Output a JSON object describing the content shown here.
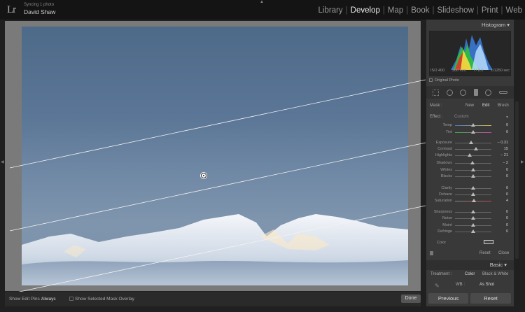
{
  "app": {
    "logo": "Lr",
    "sync_status": "Syncing 1 photo",
    "user": "David Shaw"
  },
  "modules": [
    {
      "label": "Library"
    },
    {
      "label": "Develop",
      "active": true
    },
    {
      "label": "Map"
    },
    {
      "label": "Book"
    },
    {
      "label": "Slideshow"
    },
    {
      "label": "Print"
    },
    {
      "label": "Web"
    }
  ],
  "histogram": {
    "title": "Histogram",
    "iso": "ISO 400",
    "focal": "200 mm",
    "aperture": "f / 8.0",
    "shutter": "1/1250 sec",
    "original_photo": "Original Photo"
  },
  "mask": {
    "label": "Mask :",
    "new": "New",
    "edit": "Edit",
    "brush": "Brush"
  },
  "effect": {
    "label": "Effect :",
    "value": "Custom"
  },
  "sliders": [
    {
      "label": "Temp",
      "value": "0",
      "level": 0.5
    },
    {
      "label": "Tint",
      "value": "0",
      "level": 0.5
    },
    {
      "label": "Exposure",
      "value": "− 0.31",
      "level": 0.45
    },
    {
      "label": "Contrast",
      "value": "15",
      "level": 0.58
    },
    {
      "label": "Highlights",
      "value": "− 21",
      "level": 0.4
    },
    {
      "label": "Shadows",
      "value": "− 2",
      "level": 0.49
    },
    {
      "label": "Whites",
      "value": "0",
      "level": 0.5
    },
    {
      "label": "Blacks",
      "value": "0",
      "level": 0.5
    },
    {
      "label": "Clarity",
      "value": "0",
      "level": 0.5
    },
    {
      "label": "Dehaze",
      "value": "0",
      "level": 0.5
    },
    {
      "label": "Saturation",
      "value": "4",
      "level": 0.52
    },
    {
      "label": "Sharpness",
      "value": "0",
      "level": 0.5
    },
    {
      "label": "Noise",
      "value": "0",
      "level": 0.5
    },
    {
      "label": "Moiré",
      "value": "0",
      "level": 0.5
    },
    {
      "label": "Defringe",
      "value": "0",
      "level": 0.5
    }
  ],
  "color_label": "Color",
  "reset_label": "Reset",
  "close_label": "Close",
  "basic": {
    "title": "Basic",
    "treatment_label": "Treatment :",
    "color": "Color",
    "bw": "Black & White",
    "wb_label": "WB :",
    "wb_value": "As Shot"
  },
  "bottom": {
    "show_pins_label": "Show Edit Pins :",
    "show_pins_value": "Always",
    "overlay_label": "Show Selected Mask Overlay",
    "done": "Done"
  },
  "buttons": {
    "previous": "Previous",
    "reset": "Reset"
  },
  "colors": {
    "accent": "#e6e6e6",
    "panel": "#393939"
  }
}
